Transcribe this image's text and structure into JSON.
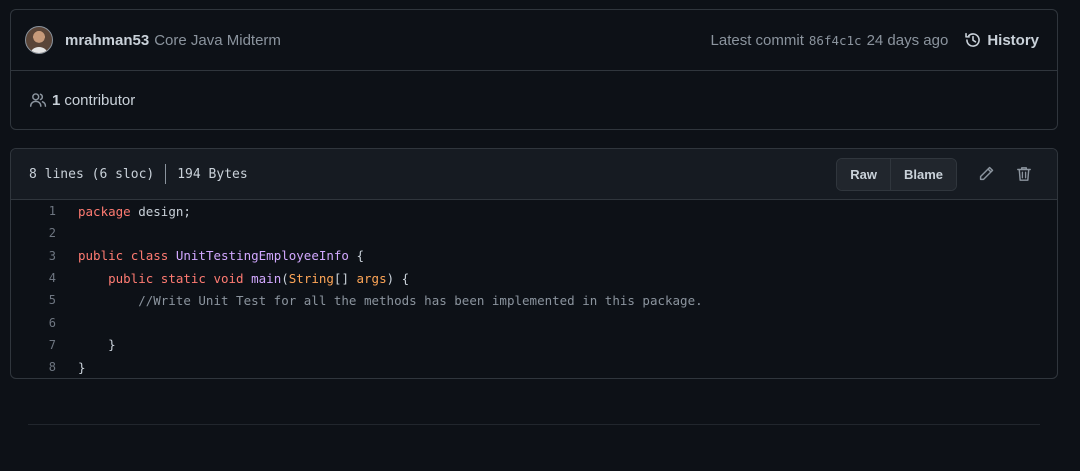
{
  "commit": {
    "author": "mrahman53",
    "message": "Core Java Midterm",
    "latest_label": "Latest commit",
    "sha": "86f4c1c",
    "ago": "24 days ago",
    "history_label": "History",
    "contributors_count": "1",
    "contributors_label": "contributor"
  },
  "file": {
    "lines_info": "8 lines (6 sloc)",
    "size": "194 Bytes",
    "raw_label": "Raw",
    "blame_label": "Blame"
  },
  "code": {
    "lines": [
      {
        "n": "1"
      },
      {
        "n": "2"
      },
      {
        "n": "3"
      },
      {
        "n": "4"
      },
      {
        "n": "5"
      },
      {
        "n": "6"
      },
      {
        "n": "7"
      },
      {
        "n": "8"
      }
    ],
    "tokens": {
      "l1_kw": "package",
      "l1_rest": " design;",
      "l3_kw1": "public",
      "l3_kw2": "class",
      "l3_name": "UnitTestingEmployeeInfo",
      "l3_rest": " {",
      "l4_indent": "    ",
      "l4_kw1": "public",
      "l4_kw2": "static",
      "l4_kw3": "void",
      "l4_fn": "main",
      "l4_p1": "(",
      "l4_type": "String",
      "l4_p2": "[] ",
      "l4_arg": "args",
      "l4_p3": ") {",
      "l5_comment": "        //Write Unit Test for all the methods has been implemented in this package.",
      "l7": "    }",
      "l8": "}"
    }
  },
  "colors": {
    "background": "#0d1117",
    "border": "#30363d",
    "keyword": "#ff7b72",
    "entity": "#d2a8ff",
    "type": "#ffa657",
    "comment": "#8b949e"
  }
}
